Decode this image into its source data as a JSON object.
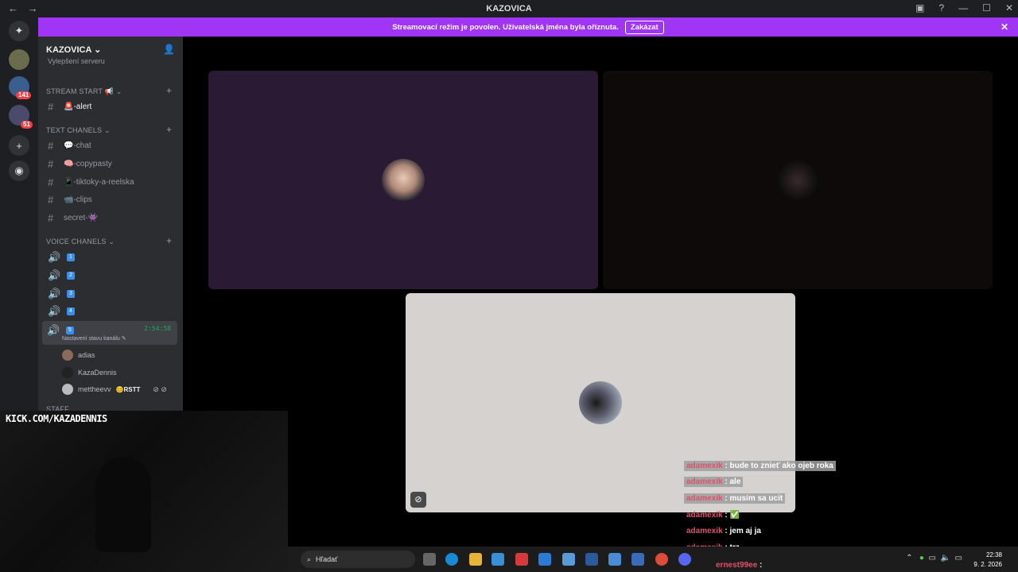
{
  "window": {
    "title": "KAZOVICA",
    "nav_back": "←",
    "nav_forward": "→"
  },
  "banner": {
    "text": "Streamovací režim je povolen. Uživatelská jména byla oříznuta.",
    "button": "Zakázat"
  },
  "rail": {
    "badges": [
      "141",
      "51"
    ]
  },
  "sidebar": {
    "server_name": "KAZOVICA",
    "truncated_item": "Vylepšení serveru",
    "categories": [
      {
        "label": "STREAM START 📢"
      },
      {
        "label": "TEXT CHANELS"
      },
      {
        "label": "VOICE CHANELS"
      },
      {
        "label": "STAFF"
      }
    ],
    "channels": [
      {
        "label": "🚨-alert"
      },
      {
        "label": "💬-chat"
      },
      {
        "label": "🧠-copypasty"
      },
      {
        "label": "📱-tiktoky-a-reelska"
      },
      {
        "label": "📹-clips"
      },
      {
        "label": "secret-👾"
      }
    ],
    "voice": [
      {
        "label": "1"
      },
      {
        "label": "2"
      },
      {
        "label": "3"
      },
      {
        "label": "4"
      },
      {
        "label": "5",
        "timer": "2:54:58",
        "status": "Nastavení stavu kanálu"
      }
    ],
    "members": [
      {
        "name": "adias"
      },
      {
        "name": "KazaDennis"
      },
      {
        "name": "mettheevv",
        "tag": "😊RSTT"
      }
    ]
  },
  "overlay": {
    "kick": "KICK.COM/KAZADENNIS"
  },
  "chat": [
    {
      "user": "adamexik",
      "msg": ": bude to znieť ako ojeb roka"
    },
    {
      "user": "adamexik",
      "msg": ": ale"
    },
    {
      "user": "adamexik",
      "msg": ": musim sa ucit"
    },
    {
      "user": "adamexik",
      "msg": ": ✅"
    },
    {
      "user": "adamexik",
      "msg": ": jem aj ja"
    },
    {
      "user": "adamexik",
      "msg": ": trz"
    },
    {
      "user": "ernest99ee",
      "msg": ":"
    }
  ],
  "taskbar": {
    "search_placeholder": "Hľadať",
    "time": "22:38",
    "date": "9. 2. 2026"
  },
  "colors": {
    "banner": "#a035f5",
    "tile_left": "#2a1a33",
    "tile_right": "#0e0a0a",
    "tile_bottom": "#d6d2cf",
    "speaking": "#23a559"
  }
}
